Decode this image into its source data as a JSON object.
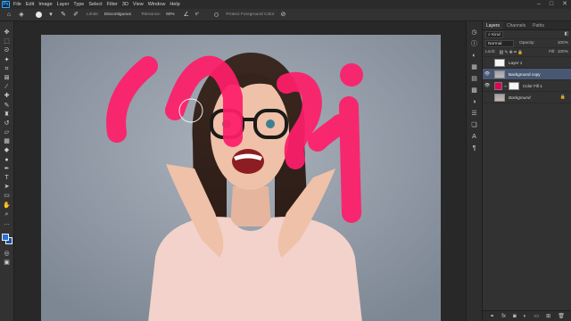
{
  "menubar": {
    "logo": "Ps",
    "items": [
      "File",
      "Edit",
      "Image",
      "Layer",
      "Type",
      "Select",
      "Filter",
      "3D",
      "View",
      "Window",
      "Help"
    ],
    "window_controls": [
      "–",
      "□",
      "✕"
    ]
  },
  "options": {
    "limits_label": "Limits:",
    "limits_value": "Discontiguous",
    "tolerance_label": "Tolerance:",
    "tolerance_value": "50%",
    "angle_value": "0°",
    "protect_label": "Protect Foreground Color"
  },
  "tools": [
    "move-icon",
    "marquee-icon",
    "lasso-icon",
    "quick-select-icon",
    "crop-icon",
    "frame-icon",
    "eyedropper-icon",
    "healing-icon",
    "brush-icon",
    "stamp-icon",
    "history-brush-icon",
    "eraser-icon",
    "gradient-icon",
    "blur-icon",
    "dodge-icon",
    "pen-icon",
    "type-icon",
    "path-select-icon",
    "rectangle-icon",
    "hand-icon",
    "zoom-icon",
    "more-icon"
  ],
  "foreground_color": "#2a6fd6",
  "background_color": "#1c4faa",
  "panel": {
    "tabs": [
      "Layers",
      "Channels",
      "Paths"
    ],
    "kind_label": "Kind",
    "blend_mode": "Normal",
    "opacity_label": "Opacity:",
    "opacity_value": "100%",
    "lock_label": "Lock:",
    "fill_label": "Fill:",
    "fill_value": "100%",
    "layers": [
      {
        "name": "Layer 1",
        "visible": false
      },
      {
        "name": "Background copy",
        "visible": true,
        "selected": true
      },
      {
        "name": "Color Fill 1",
        "visible": true,
        "fill_color": "#e0005a"
      },
      {
        "name": "Background",
        "visible": false,
        "locked": true
      }
    ]
  },
  "paint_color": "#ff1e6a"
}
